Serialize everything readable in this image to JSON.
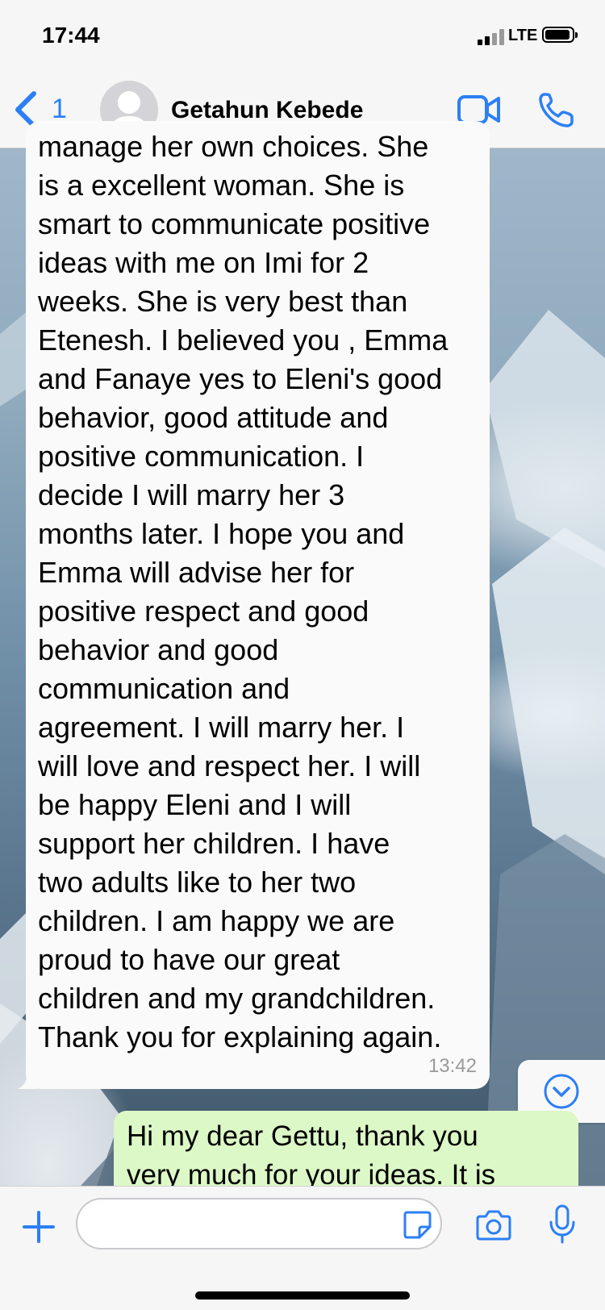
{
  "status_bar": {
    "time": "17:44",
    "network": "LTE"
  },
  "header": {
    "back_count": "1",
    "contact_name": "Getahun Kebede",
    "icons": [
      "chevron-left-icon",
      "avatar-placeholder",
      "video-camera-icon",
      "phone-icon"
    ],
    "accent_color": "#2c7ff5"
  },
  "messages": [
    {
      "direction": "incoming",
      "text": "manage her own choices. She\nis a excellent woman. She is\nsmart to communicate positive\nideas with me on Imi for 2\nweeks. She is very best than\nEtenesh. I believed you , Emma\nand Fanaye yes to Eleni's good\nbehavior, good attitude and\npositive communication. I\ndecide I will marry her 3\nmonths later. I hope you and\nEmma will advise her for\npositive respect and good\nbehavior and good\ncommunication and\nagreement. I will marry her. I\nwill love and respect her. I will\nbe happy Eleni and I will\nsupport her children. I have\ntwo adults like to her two\nchildren. I am happy we are\nproud to have our great\nchildren and my grandchildren.\nThank you for explaining again.",
      "time": "13:42"
    },
    {
      "direction": "outgoing",
      "text": "Hi my dear Gettu, thank you\nvery much for your ideas. It is",
      "color": "#dcf8c6"
    }
  ],
  "input_bar": {
    "placeholder": "",
    "icons": [
      "plus-icon",
      "sticker-icon",
      "camera-icon",
      "microphone-icon"
    ]
  },
  "scroll_button": {
    "icon": "chevron-down-circle-icon"
  }
}
